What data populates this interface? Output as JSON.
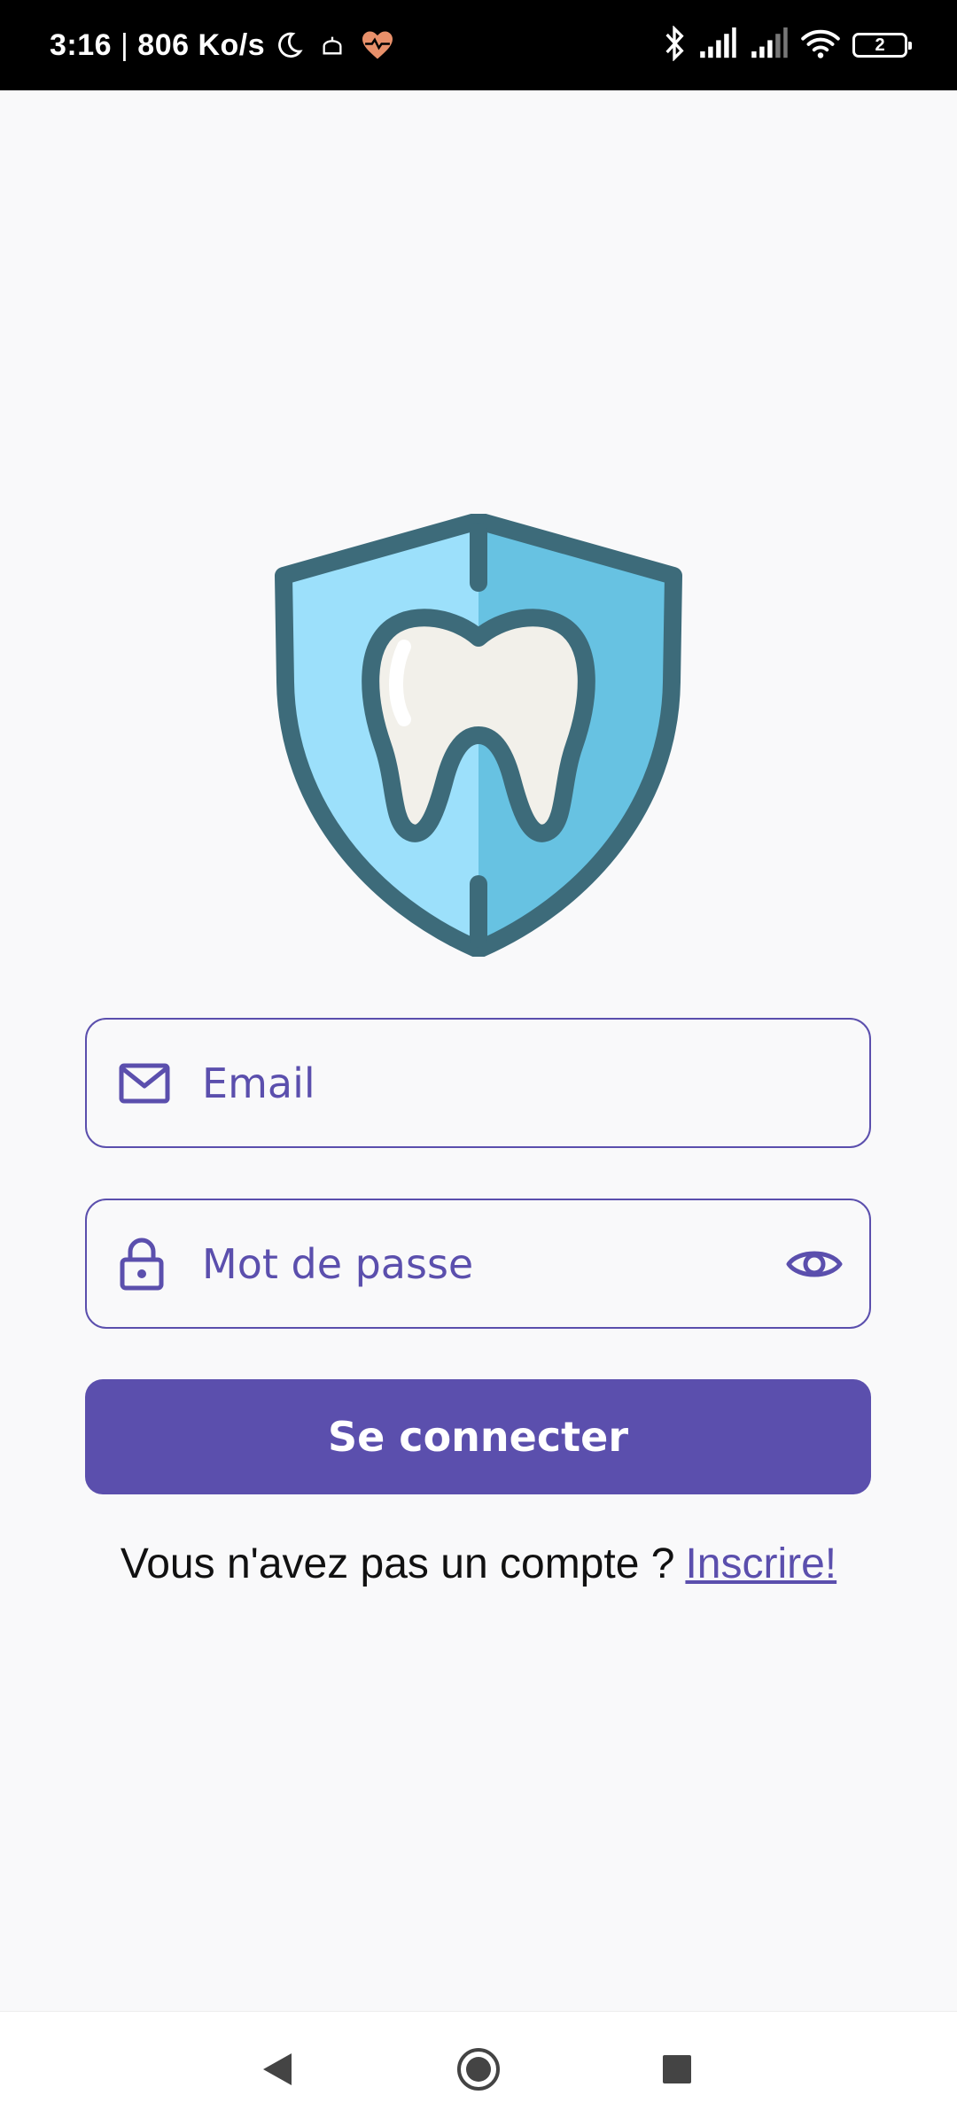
{
  "status_bar": {
    "time": "3:16",
    "separator": " | ",
    "network_speed": "806 Ko/s",
    "battery_level": "2",
    "icons": [
      "moon-icon",
      "mosque-icon",
      "heart-pulse-icon",
      "bluetooth-icon",
      "signal-icon",
      "signal-icon-2",
      "wifi-icon",
      "battery-icon"
    ]
  },
  "logo": {
    "icon": "tooth-shield-logo"
  },
  "form": {
    "email_placeholder": "Email",
    "email_value": "",
    "password_placeholder": "Mot de passe",
    "password_value": "",
    "submit_label": "Se connecter"
  },
  "signup": {
    "prompt": "Vous n'avez pas un compte ?",
    "link_label": "Inscrire!"
  },
  "nav_bar": {
    "icons": [
      "back-icon",
      "home-icon",
      "recents-icon"
    ]
  },
  "colors": {
    "accent": "#5b4fad",
    "background": "#f9f9fa",
    "shield_outline": "#3d6b7a",
    "shield_left": "#9ce0fb",
    "shield_right": "#67c2e2",
    "tooth": "#f2f0ea"
  }
}
